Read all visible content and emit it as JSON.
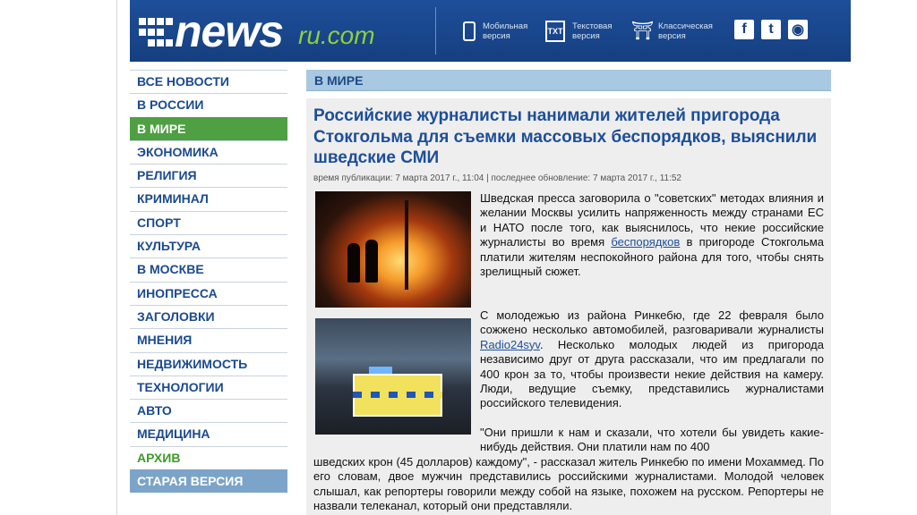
{
  "header": {
    "logo_main": "news",
    "logo_ru": "ru.com",
    "links": [
      {
        "line1": "Мобильная",
        "line2": "версия",
        "icon": "mobile-icon"
      },
      {
        "line1": "Текстовая",
        "line2": "версия",
        "icon": "txt-icon",
        "icon_text": "TXT"
      },
      {
        "line1": "Классическая",
        "line2": "версия",
        "icon": "classic-column-icon"
      }
    ],
    "social": [
      {
        "glyph": "f",
        "name": "facebook-icon"
      },
      {
        "glyph": "t",
        "name": "twitter-icon"
      },
      {
        "glyph": "◉",
        "name": "rss-icon"
      }
    ]
  },
  "sidebar": {
    "items": [
      "ВСЕ НОВОСТИ",
      "В РОССИИ",
      "В МИРЕ",
      "ЭКОНОМИКА",
      "РЕЛИГИЯ",
      "КРИМИНАЛ",
      "СПОРТ",
      "КУЛЬТУРА",
      "В МОСКВЕ",
      "ИНОПРЕССА",
      "ЗАГОЛОВКИ",
      "МНЕНИЯ",
      "НЕДВИЖИМОСТЬ",
      "ТЕХНОЛОГИИ",
      "АВТО",
      "МЕДИЦИНА",
      "АРХИВ",
      "СТАРАЯ ВЕРСИЯ"
    ],
    "active": "В МИРЕ"
  },
  "section": {
    "title": "В МИРЕ"
  },
  "article": {
    "title": "Российские журналисты нанимали жителей пригорода Стокгольма для съемки массовых беспорядков, выяснили шведские СМИ",
    "meta": "время публикации: 7 марта 2017 г., 11:04 | последнее обновление: 7 марта 2017 г., 11:52",
    "p1_before": "Шведская пресса заговорила о \"советских\" методах влияния и желании Москвы усилить напряженность между странами ЕС и НАТО после того, как выяснилось, что некие российские журналисты во время ",
    "p1_link": "беспорядков",
    "p1_after": " в пригороде Стокгольма платили жителям неспокойного района для того, чтобы снять зрелищный сюжет.",
    "p2_before": "С молодежью из района Ринкебю, где 22 февраля было сожжено несколько автомобилей, разговаривали журналисты ",
    "p2_link": "Radio24syv",
    "p2_after": ". Несколько молодых людей из пригорода независимо друг от друга рассказали, что им предлагали по 400 крон за то, чтобы произвести некие действия на камеру. Люди, ведущие съемку, представились журналистами российского телевидения.",
    "p3a": "\"Они пришли к нам и сказали, что хотели бы увидеть какие-нибудь действия. Они платили нам по 400",
    "p3b": "шведских крон (45 долларов) каждому\", - рассказал житель Ринкебю по имени Мохаммед. По его словам, двое мужчин представились российскими журналистами. Молодой человек слышал, как репортеры говорили между собой на языке, похожем на русском. Репортеры не назвали телеканал, который они представляли."
  }
}
